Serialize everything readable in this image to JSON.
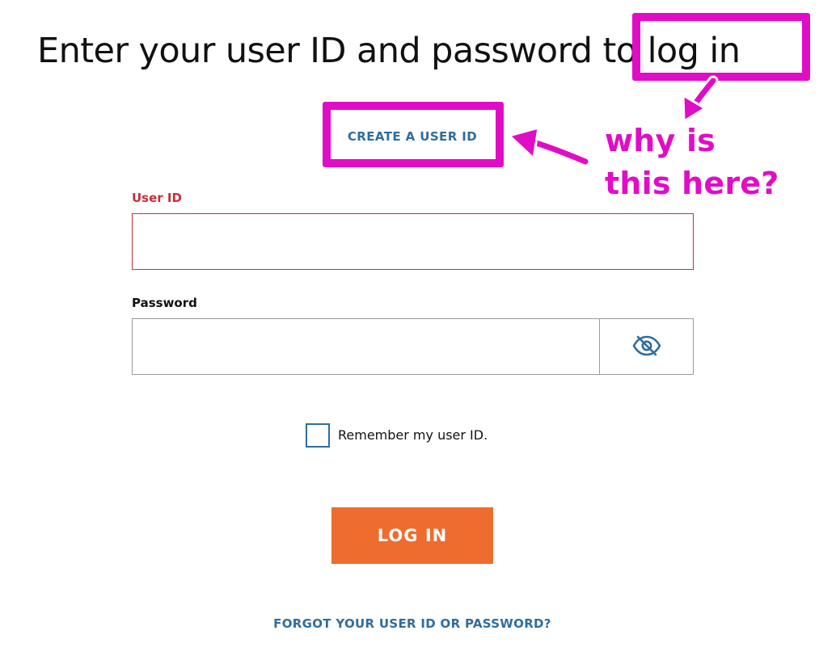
{
  "header": {
    "title": "Enter your user ID and password to log in"
  },
  "links": {
    "create_user_id": "CREATE A USER ID",
    "forgot_credentials": "FORGOT YOUR USER ID OR PASSWORD?"
  },
  "form": {
    "user_id_label": "User ID",
    "user_id_value": "",
    "user_id_state": "error",
    "password_label": "Password",
    "password_value": "",
    "password_toggle_icon": "eye-slash-icon",
    "remember_label": "Remember my user ID.",
    "remember_checked": false,
    "login_label": "LOG IN"
  },
  "annotation": {
    "note_line1": "why is",
    "note_line2": "this here?",
    "highlighted_title_text": "to log in",
    "highlighted_link_text": "CREATE A USER ID"
  },
  "colors": {
    "link_blue": "#2f6d9e",
    "error_red": "#c62f3c",
    "login_orange": "#ef6c2f",
    "annotation_magenta": "#e10dc6"
  }
}
